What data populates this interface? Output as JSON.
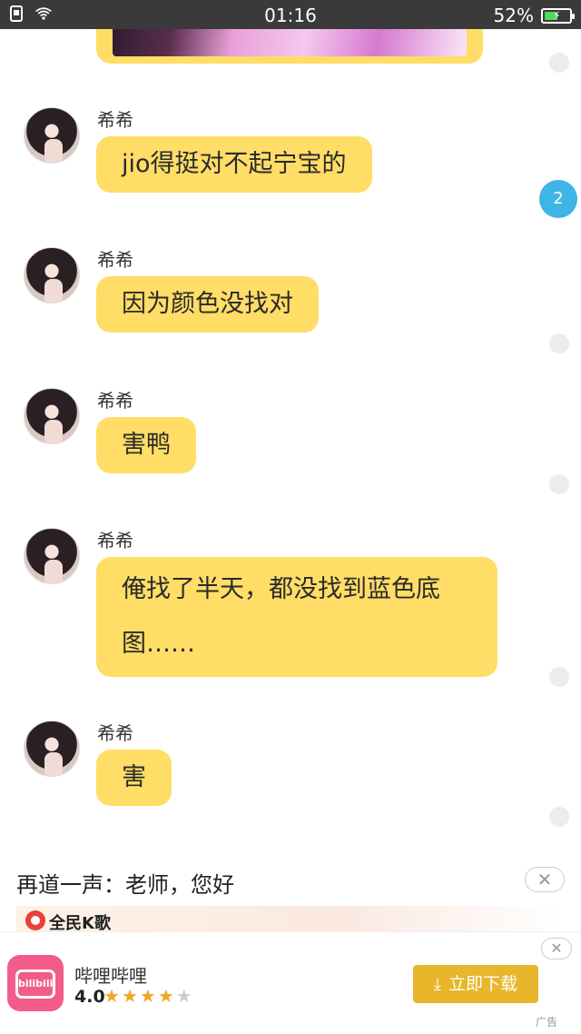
{
  "status_bar": {
    "time": "01:16",
    "battery": "52%",
    "battery_level": 0.52
  },
  "chat": {
    "unread_count": "2",
    "messages": [
      {
        "sender": "希希",
        "text": "jio得挺对不起宁宝的"
      },
      {
        "sender": "希希",
        "text": "因为颜色没找对"
      },
      {
        "sender": "希希",
        "text": "害鸭"
      },
      {
        "sender": "希希",
        "text": "俺找了半天，都没找到蓝色底图……"
      },
      {
        "sender": "希希",
        "text": "害"
      }
    ]
  },
  "notice": {
    "text": "再道一声：老师，您好",
    "close": "✕"
  },
  "banner": {
    "brand": "全民K歌"
  },
  "ad": {
    "app_icon_text": "bilibili",
    "app_name": "哔哩哔哩",
    "rating": "4.0",
    "rating_value": 4,
    "download_label": "立即下载",
    "ad_label": "广告",
    "close": "✕"
  },
  "colors": {
    "bubble": "#ffdd66",
    "unread": "#3fb4e6",
    "download": "#e8b62a"
  }
}
